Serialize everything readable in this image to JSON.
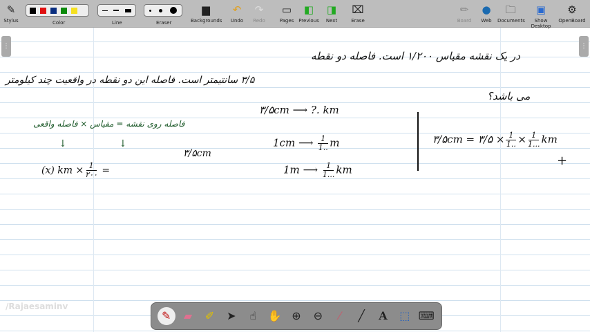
{
  "toolbar": {
    "stylus": "Stylus",
    "color": "Color",
    "line": "Line",
    "eraser": "Eraser",
    "backgrounds": "Backgrounds",
    "undo": "Undo",
    "redo": "Redo",
    "pages": "Pages",
    "previous": "Previous",
    "next": "Next",
    "erase": "Erase",
    "board": "Board",
    "web": "Web",
    "documents": "Documents",
    "show_desktop": "Show Desktop",
    "openboard": "OpenBoard",
    "colors": [
      "#000000",
      "#e01010",
      "#0a2e80",
      "#0c8a0c",
      "#f5e020"
    ]
  },
  "board": {
    "question_line1": "در یک نقشه مقیاس ۱/۲۰۰ است. فاصله دو نقطه",
    "question_line2": "۳/۵ سانتیمتر است. فاصله این دو نقطه در واقعیت چند کیلومتر",
    "question_line3": "می باشد؟",
    "formula_words": "فاصله روی نقشه = مقیاس × فاصله واقعی",
    "formula_lhs": "(x) km ×",
    "formula_num": "1",
    "formula_den": "۲۰۰",
    "formula_eq": "=",
    "formula_rhs": "۳/۵cm",
    "row1_left": "۳/۵cm",
    "row1_right": "?. km",
    "row2_left": "1cm",
    "row2_num": "1",
    "row2_den": "1..",
    "row2_unit": "m",
    "row3_left": "1m",
    "row3_num": "1",
    "row3_den": "1...",
    "row3_unit": "km",
    "result_left": "۳/۵cm = ۳/۵ ×",
    "result_num1": "1",
    "result_den1": "1..",
    "result_times": "×",
    "result_num2": "1",
    "result_den2": "1...",
    "result_unit": "km",
    "arrow": "⟶"
  },
  "watermark": "/Rajaesaminv"
}
